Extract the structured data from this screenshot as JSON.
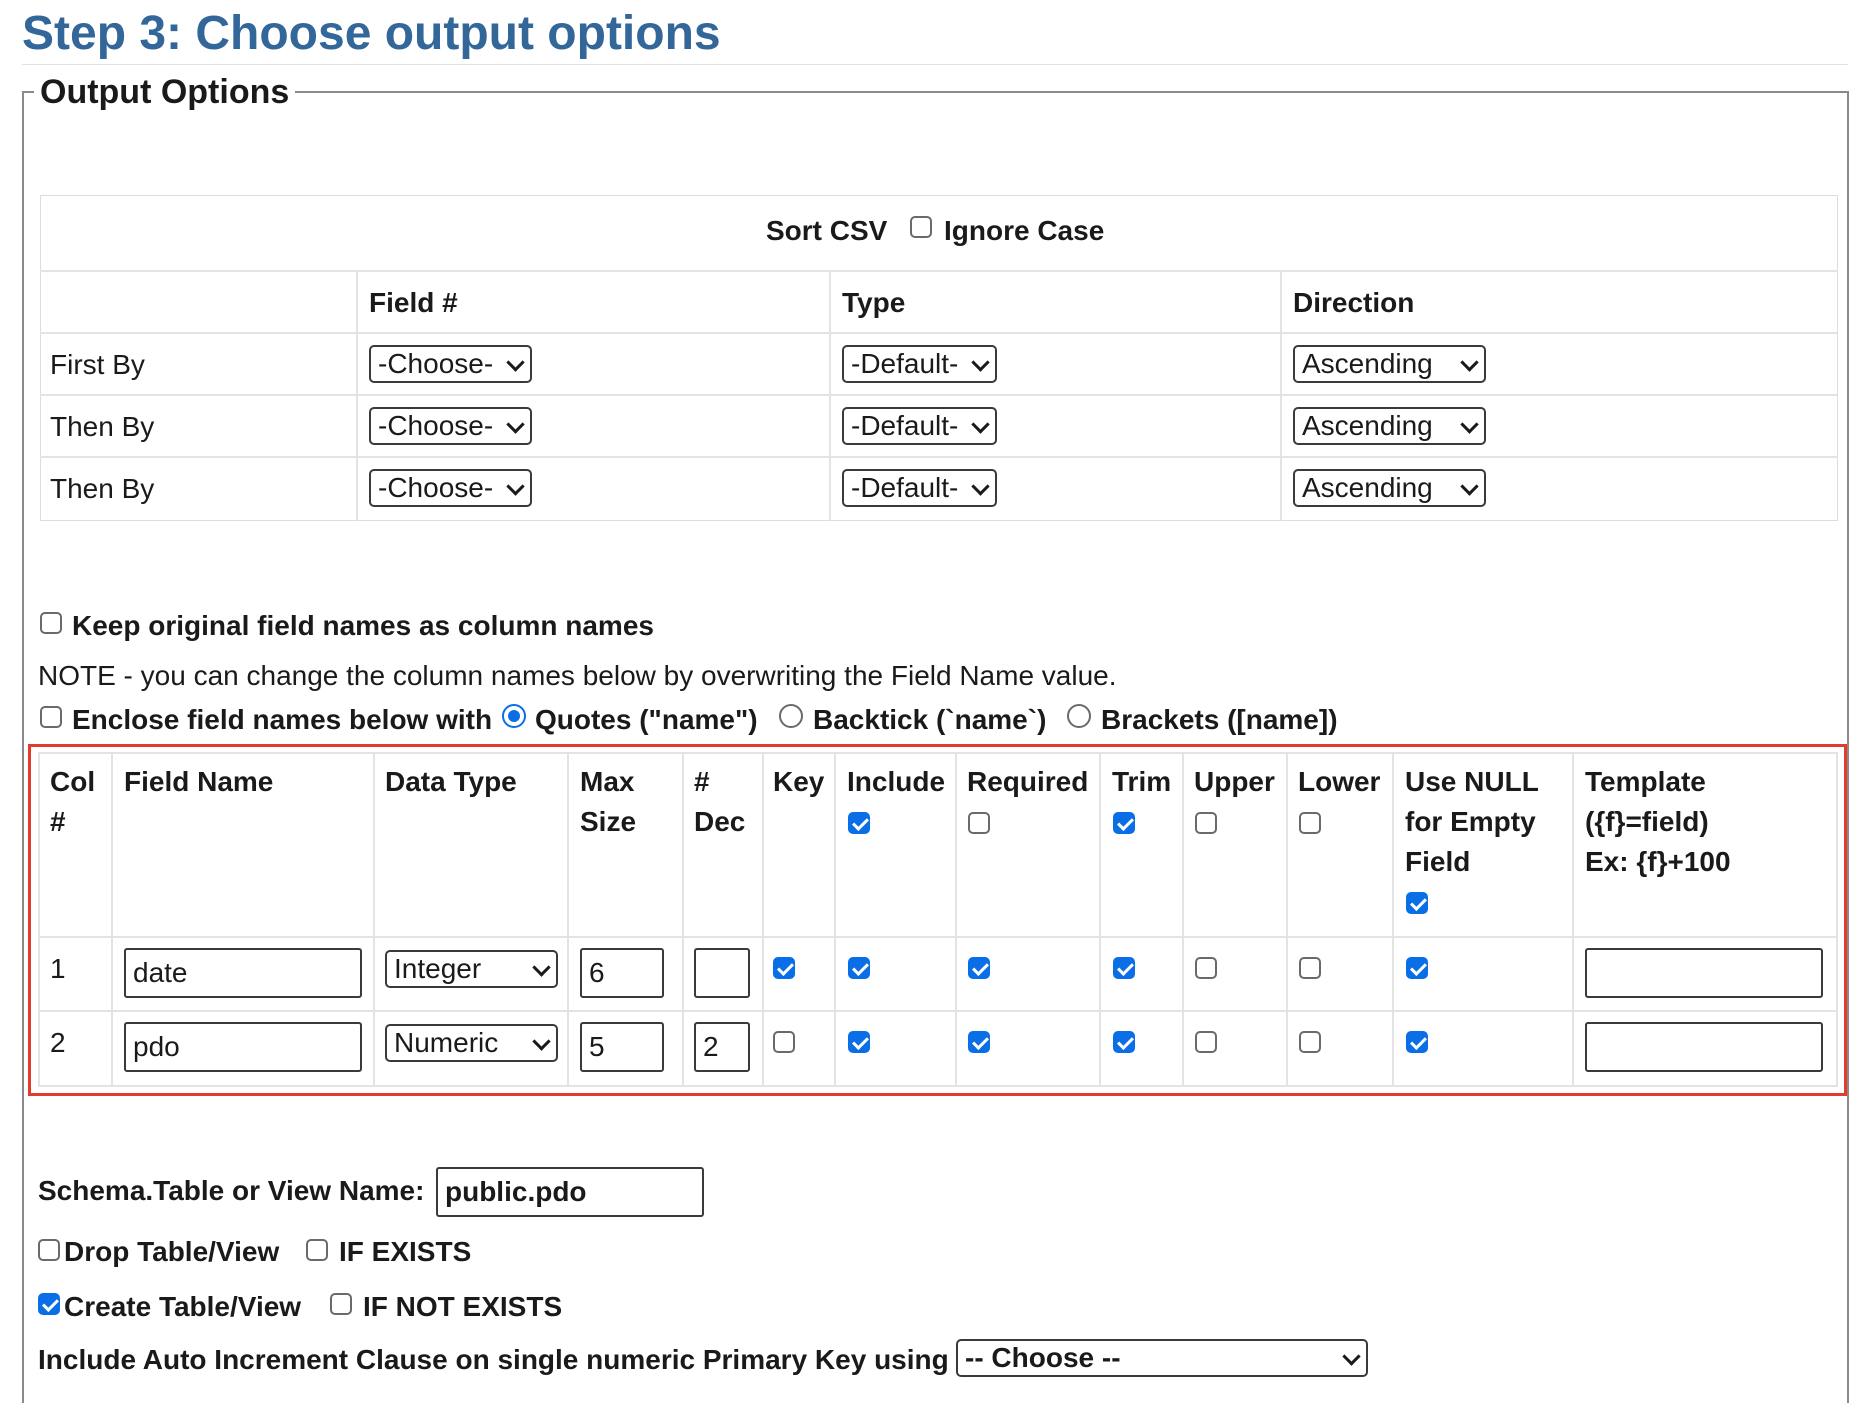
{
  "step_title": "Step 3: Choose output options",
  "legend": "Output Options",
  "sort": {
    "header_label": "Sort CSV",
    "ignore_case_label": "Ignore Case",
    "ignore_case_checked": false,
    "columns": [
      "Field #",
      "Type",
      "Direction"
    ],
    "rows": [
      {
        "label": "First By",
        "field": "-Choose-",
        "type": "-Default-",
        "direction": "Ascending"
      },
      {
        "label": "Then By",
        "field": "-Choose-",
        "type": "-Default-",
        "direction": "Ascending"
      },
      {
        "label": "Then By",
        "field": "-Choose-",
        "type": "-Default-",
        "direction": "Ascending"
      }
    ]
  },
  "keep_original_label": "Keep original field names as column names",
  "keep_original_checked": false,
  "note": "NOTE - you can change the column names below by overwriting the Field Name value.",
  "enclose": {
    "label": "Enclose field names below with",
    "checked": false,
    "options": [
      {
        "label": "Quotes (\"name\")",
        "selected": true
      },
      {
        "label": "Backtick (`name`)",
        "selected": false
      },
      {
        "label": "Brackets ([name])",
        "selected": false
      }
    ]
  },
  "fields_table": {
    "headers": {
      "col_line1": "Col",
      "col_line2": "#",
      "field_name": "Field Name",
      "data_type": "Data Type",
      "max_line1": "Max",
      "max_line2": "Size",
      "dec_line1": "#",
      "dec_line2": "Dec",
      "key": "Key",
      "include": "Include",
      "required": "Required",
      "trim": "Trim",
      "upper": "Upper",
      "lower": "Lower",
      "null_line1": "Use NULL",
      "null_line2": "for Empty",
      "null_line3": "Field",
      "template_line1": "Template",
      "template_line2": "({f}=field)",
      "template_line3": "Ex: {f}+100"
    },
    "header_checks": {
      "include": true,
      "required": false,
      "trim": true,
      "upper": false,
      "lower": false,
      "use_null": true
    },
    "rows": [
      {
        "col": "1",
        "field_name": "date",
        "data_type": "Integer",
        "max_size": "6",
        "dec": "",
        "key": true,
        "include": true,
        "required": true,
        "trim": true,
        "upper": false,
        "lower": false,
        "use_null": true,
        "template": ""
      },
      {
        "col": "2",
        "field_name": "pdo",
        "data_type": "Numeric",
        "max_size": "5",
        "dec": "2",
        "key": false,
        "include": true,
        "required": true,
        "trim": true,
        "upper": false,
        "lower": false,
        "use_null": true,
        "template": ""
      }
    ]
  },
  "schema_label": "Schema.Table or View Name:",
  "schema_value": "public.pdo",
  "drop": {
    "label": "Drop Table/View",
    "checked": false,
    "if_label": "IF EXISTS",
    "if_checked": false
  },
  "create": {
    "label": "Create Table/View",
    "checked": true,
    "if_label": "IF NOT EXISTS",
    "if_checked": false
  },
  "auto_increment_label": "Include Auto Increment Clause on single numeric Primary Key using",
  "auto_increment_value": "-- Choose --",
  "colors": {
    "title": "#336699",
    "highlight_frame": "#e13b2a",
    "checkbox_on": "#0a6fe6"
  }
}
